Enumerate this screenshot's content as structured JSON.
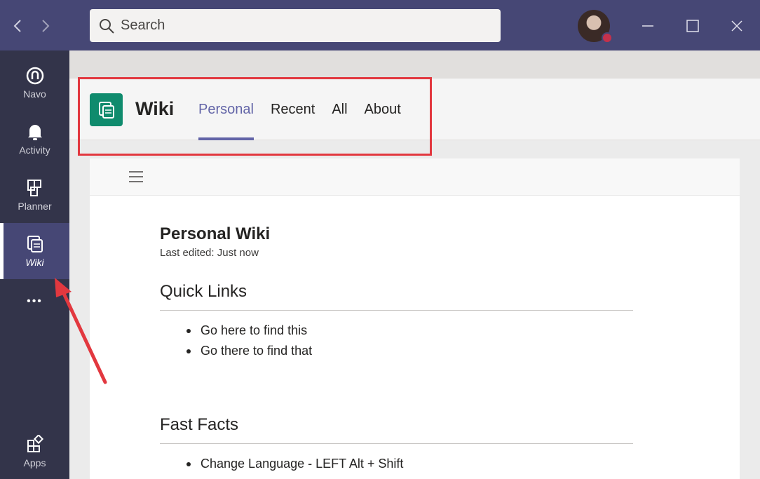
{
  "titlebar": {
    "search_placeholder": "Search"
  },
  "rail": {
    "items": [
      {
        "label": "Navo",
        "icon": "navo-icon"
      },
      {
        "label": "Activity",
        "icon": "bell-icon"
      },
      {
        "label": "Planner",
        "icon": "planner-icon"
      },
      {
        "label": "Wiki",
        "icon": "wiki-icon"
      },
      {
        "label": "Apps",
        "icon": "apps-icon"
      }
    ],
    "more_label": "•••"
  },
  "app": {
    "name": "Wiki",
    "tabs": [
      {
        "label": "Personal",
        "active": true
      },
      {
        "label": "Recent",
        "active": false
      },
      {
        "label": "All",
        "active": false
      },
      {
        "label": "About",
        "active": false
      }
    ]
  },
  "doc": {
    "title": "Personal Wiki",
    "edited": "Last edited: Just now",
    "sections": [
      {
        "heading": "Quick Links",
        "items": [
          "Go here to find this",
          "Go there to find that"
        ]
      },
      {
        "heading": "Fast Facts",
        "items": [
          "Change Language - LEFT Alt + Shift"
        ]
      }
    ]
  },
  "colors": {
    "titlebar": "#464775",
    "rail": "#33344a",
    "accent": "#6264a7",
    "wiki_logo": "#0f8b6d",
    "annotation": "#e2383f"
  }
}
